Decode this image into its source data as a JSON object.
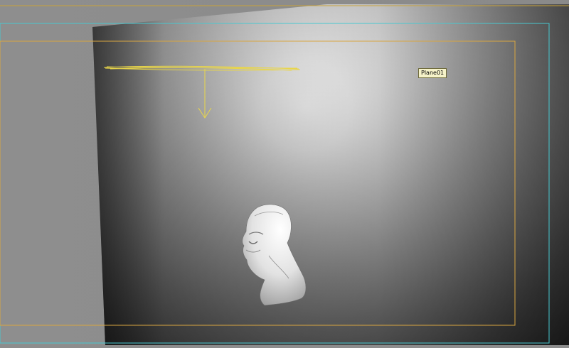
{
  "viewport": {
    "object_tooltip": "Plane01",
    "colors": {
      "background": "#8d8d8d",
      "safe_frame_outer": "#c8a23a",
      "safe_frame_action": "#48c8d0",
      "safe_frame_title": "#d9a640",
      "light_gizmo": "#e9d64a",
      "tooltip_bg": "#f6f3c9"
    }
  }
}
